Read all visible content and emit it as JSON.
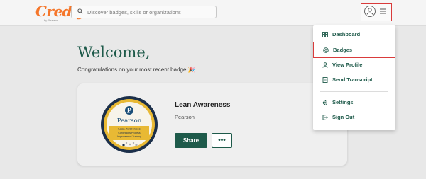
{
  "header": {
    "logo_text": "Credly",
    "logo_sub": "by Pearson",
    "search_placeholder": "Discover badges, skills or organizations"
  },
  "main": {
    "welcome_title": "Welcome,",
    "congrats_text": "Congratulations on your most recent badge 🎉"
  },
  "badge_card": {
    "badge_title": "Lean Awareness",
    "issuer": "Pearson",
    "share_label": "Share",
    "more_label": "•••",
    "badge_image": {
      "brand": "Pearson",
      "line1": "Lean Awareness",
      "line2": "Continuous Process",
      "line3": "Improvement Training"
    }
  },
  "menu": {
    "items": [
      {
        "label": "Dashboard",
        "icon": "dashboard-icon"
      },
      {
        "label": "Badges",
        "icon": "badge-icon"
      },
      {
        "label": "View Profile",
        "icon": "profile-icon"
      },
      {
        "label": "Send Transcript",
        "icon": "transcript-icon"
      },
      {
        "label": "Settings",
        "icon": "gear-icon"
      },
      {
        "label": "Sign Out",
        "icon": "sign-out-icon"
      }
    ]
  },
  "colors": {
    "brand_orange": "#f5762a",
    "primary_green": "#1e5a4a",
    "highlight_red": "#d93b3b",
    "background": "#e8e8e8"
  }
}
